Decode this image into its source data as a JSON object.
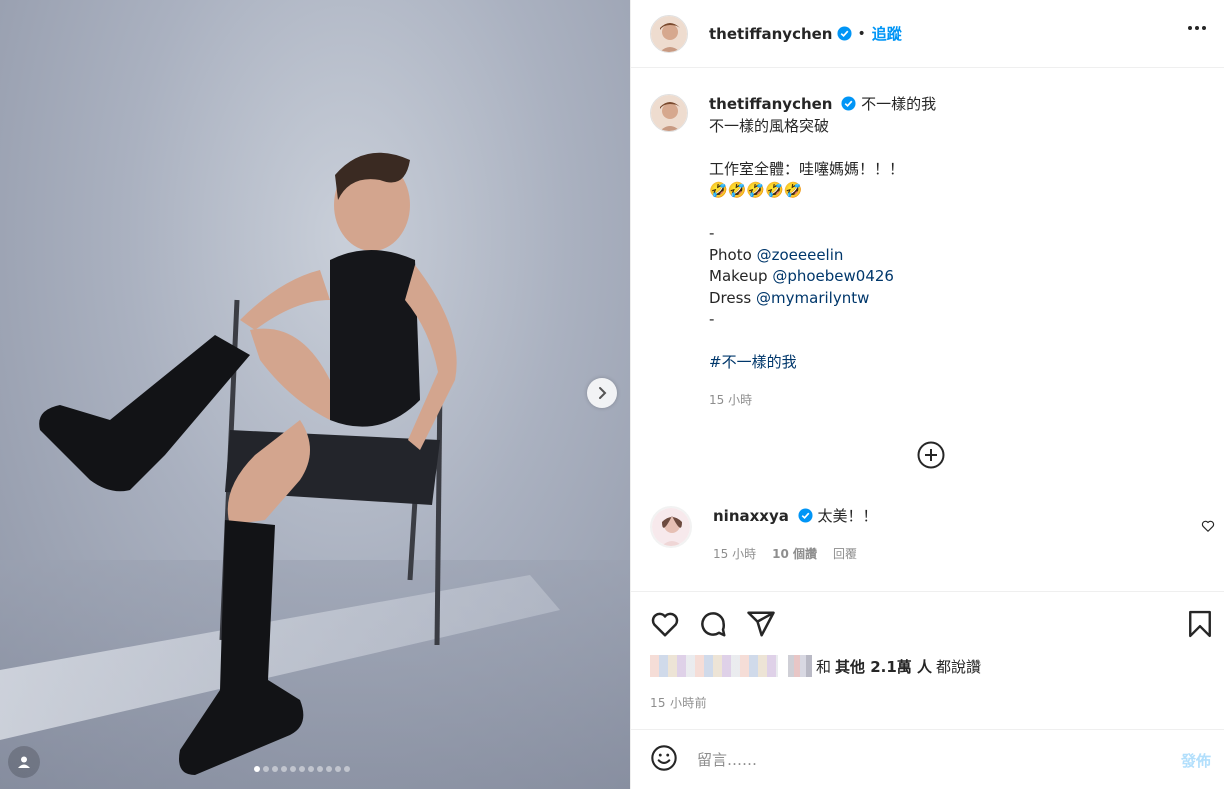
{
  "post": {
    "username": "thetiffanychen",
    "follow_label": "追蹤",
    "separator": "•",
    "caption_lines": [
      "不一樣的我",
      "不一樣的風格突破",
      "",
      "工作室全體：哇噻媽媽！！！",
      "🤣🤣🤣🤣🤣",
      "",
      "-"
    ],
    "credits": [
      {
        "label": "Photo",
        "handle": "@zoeeeelin"
      },
      {
        "label": "Makeup",
        "handle": "@phoebew0426"
      },
      {
        "label": "Dress",
        "handle": "@mymarilyntw"
      }
    ],
    "dash_end": "-",
    "hashtag": "#不一樣的我",
    "caption_time": "15 小時",
    "carousel": {
      "total": 11,
      "active_index": 0
    }
  },
  "comment": {
    "username": "ninaxxya",
    "text": "太美！！",
    "time": "15 小時",
    "likes": "10 個讚",
    "reply": "回覆"
  },
  "likes": {
    "text_and": "和",
    "text_others": "其他 2.1萬 人",
    "text_liked": "都說讚"
  },
  "post_time": "15 小時前",
  "comment_box": {
    "placeholder": "留言……",
    "post_label": "發佈"
  },
  "icons": [
    "verified-icon",
    "more-icon",
    "chevron-right-icon",
    "user-tag-icon",
    "add-circle-icon",
    "heart-icon",
    "comment-icon",
    "share-icon",
    "bookmark-icon",
    "emoji-icon"
  ],
  "colors": {
    "link": "#00376b",
    "follow": "#0095f6",
    "verified": "#0095f6",
    "post_disabled": "#b2dffc"
  }
}
